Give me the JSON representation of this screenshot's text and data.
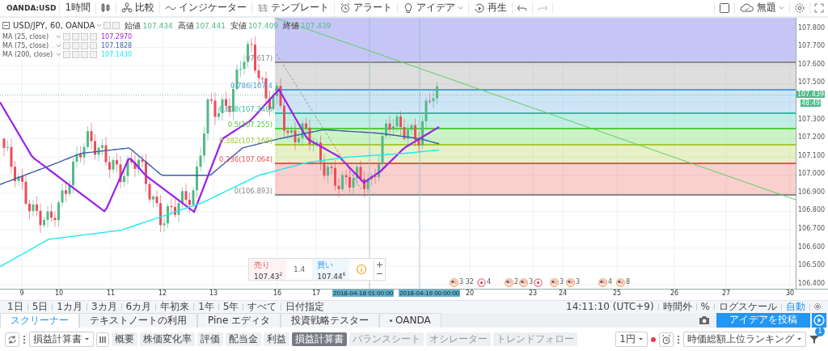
{
  "toolbar": {
    "symbol": "OANDA:USD",
    "interval": "1時間",
    "items": [
      {
        "kind": "candles"
      },
      {
        "kind": "compare",
        "label": "比較"
      },
      {
        "kind": "indicator",
        "label": "インジケーター"
      },
      {
        "kind": "template",
        "label": "テンプレート"
      },
      {
        "kind": "alert",
        "label": "アラート"
      },
      {
        "kind": "idea",
        "label": "アイデア",
        "dropdown": true
      },
      {
        "kind": "replay",
        "label": "再生"
      },
      {
        "kind": "undo"
      },
      {
        "kind": "redo"
      }
    ],
    "layout_name": "無題"
  },
  "legend": {
    "title": "USD/JPY, 60, OANDA",
    "ohlc": [
      {
        "label": "始値",
        "value": "107.434"
      },
      {
        "label": "高値",
        "value": "107.441"
      },
      {
        "label": "安値",
        "value": "107.409"
      },
      {
        "label": "終値",
        "value": "107.439"
      }
    ],
    "indicators": [
      {
        "name": "MA (25, close)",
        "value": "107.2970",
        "color": "#9c1fe8"
      },
      {
        "name": "MA (75, close)",
        "value": "107.1828",
        "color": "#3b5ea8"
      },
      {
        "name": "MA (200, close)",
        "value": "107.1430",
        "color": "#1de9f2"
      }
    ]
  },
  "fibonacci": {
    "levels": [
      {
        "kind": "extension",
        "color": "#c6c6f6"
      },
      {
        "kind": "level",
        "label": "07.617)",
        "color": "#8a8a8a"
      },
      {
        "kind": "level",
        "label": "0.786(107.4",
        "color": "#4aa3df"
      },
      {
        "kind": "level",
        "label": "0.618(107.340)",
        "color": "#2ebfa5"
      },
      {
        "kind": "level",
        "label": "0.5(107.255)",
        "color": "#4cd038"
      },
      {
        "kind": "level",
        "label": "0.382(107.169)",
        "color": "#a8c935"
      },
      {
        "kind": "level",
        "label": "0.236(107.064)",
        "color": "#e8564e"
      },
      {
        "kind": "level",
        "label": "0(106.893)",
        "color": "#8a8a8a"
      }
    ]
  },
  "price_axis": {
    "ticks": [
      "107.800",
      "107.700",
      "107.600",
      "107.500",
      "107.300",
      "107.200",
      "107.100",
      "107.000",
      "106.900",
      "106.800",
      "106.700",
      "106.600",
      "106.500",
      "106.400"
    ],
    "last_price": "107.439",
    "countdown": "48:49"
  },
  "trade_panel": {
    "sell_label": "売り",
    "sell_price": "107.43$^{2}$",
    "spread": "1.4",
    "buy_label": "買い",
    "buy_price": "107.44$^{6}$"
  },
  "events": [
    {
      "kind": "flag",
      "label": "3 32"
    },
    {
      "kind": "circle",
      "label": "4"
    },
    {
      "kind": "flag",
      "label": "2"
    },
    {
      "kind": "flag",
      "label": "3"
    },
    {
      "kind": "circle"
    },
    {
      "kind": "flag",
      "label": "3"
    },
    {
      "kind": "flag",
      "label": "3"
    },
    {
      "kind": "flag",
      "label": "4"
    },
    {
      "kind": "flag",
      "label": "8"
    }
  ],
  "time_axis": {
    "labels": [
      {
        "kind": "date",
        "text": "9"
      },
      {
        "kind": "date",
        "text": "10"
      },
      {
        "kind": "date",
        "text": "11"
      },
      {
        "kind": "date",
        "text": "12"
      },
      {
        "kind": "date",
        "text": "13"
      },
      {
        "kind": "date",
        "text": "16"
      },
      {
        "kind": "date",
        "text": "17"
      },
      {
        "kind": "cursor",
        "text": "2018-04-18 01:00:00"
      },
      {
        "kind": "cursor",
        "text": "2018-04-19 00:00:00"
      },
      {
        "kind": "date",
        "text": "20"
      },
      {
        "kind": "date",
        "text": "23"
      },
      {
        "kind": "date",
        "text": "24"
      },
      {
        "kind": "date",
        "text": "25"
      },
      {
        "kind": "date",
        "text": "26"
      },
      {
        "kind": "date",
        "text": "27"
      },
      {
        "kind": "date",
        "text": "30"
      }
    ]
  },
  "range_bar": {
    "ranges": [
      "1日",
      "5日",
      "1カ月",
      "3カ月",
      "6カ月",
      "年初来",
      "1年",
      "5年",
      "すべて",
      "日付指定"
    ],
    "time": "14:11:10 (UTC+9)",
    "options": [
      {
        "label": "時間外",
        "on": false
      },
      {
        "label": "%",
        "on": false
      },
      {
        "label": "ログスケール",
        "on": false
      },
      {
        "label": "自動",
        "on": true
      }
    ]
  },
  "bottom_tabs": [
    {
      "label": "スクリーナー",
      "selected": true
    },
    {
      "label": "テキストノートの利用",
      "selected": false
    },
    {
      "label": "Pine エディタ",
      "selected": false
    },
    {
      "label": "投資戦略テスター",
      "selected": false
    },
    {
      "label": "OANDA",
      "selected": false,
      "dot": true
    }
  ],
  "publish_button": "アイデアを投稿",
  "screener": {
    "preset": "損益計算書",
    "tabs": [
      {
        "label": "概要",
        "selected": false,
        "disabled": false
      },
      {
        "label": "株価変化率",
        "selected": false,
        "disabled": false
      },
      {
        "label": "評価",
        "selected": false,
        "disabled": false
      },
      {
        "label": "配当金",
        "selected": false,
        "disabled": false
      },
      {
        "label": "利益",
        "selected": false,
        "disabled": false
      },
      {
        "label": "損益計算書",
        "selected": true,
        "disabled": false
      },
      {
        "label": "バランスシート",
        "selected": false,
        "disabled": true
      },
      {
        "label": "オシレーター",
        "selected": false,
        "disabled": true
      },
      {
        "label": "トレンドフォロー",
        "selected": false,
        "disabled": true
      }
    ],
    "currency": "1円",
    "sort": "時価総額上位ランキング",
    "filter_count": "1"
  }
}
